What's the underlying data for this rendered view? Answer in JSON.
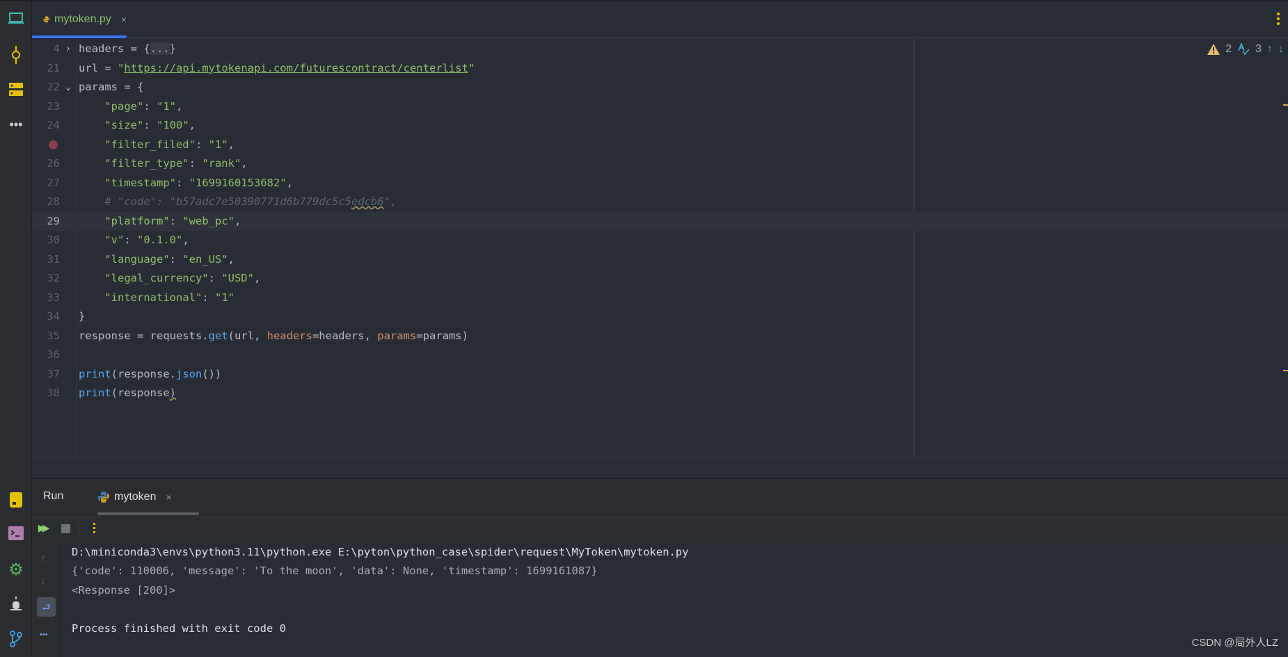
{
  "editor": {
    "tab": {
      "label": "mytoken.py",
      "close": "×",
      "icon": "python-icon"
    },
    "inspections": {
      "warnings": "2",
      "typos": "3"
    },
    "lines": [
      {
        "num": "4",
        "fold": "›",
        "tokens": [
          [
            "",
            "headers = {"
          ],
          [
            "t-fold",
            "..."
          ],
          [
            "",
            "}"
          ]
        ]
      },
      {
        "num": "21",
        "tokens": [
          [
            "",
            "url = "
          ],
          [
            "t-str",
            "\""
          ],
          [
            "t-url",
            "https://api.mytokenapi.com/futurescontract/centerlist"
          ],
          [
            "t-str",
            "\""
          ]
        ]
      },
      {
        "num": "22",
        "fold": "⌄",
        "tokens": [
          [
            "",
            "params = {"
          ]
        ]
      },
      {
        "num": "23",
        "tokens": [
          [
            "t-str",
            "    \"page\""
          ],
          [
            "",
            ": "
          ],
          [
            "t-str",
            "\"1\""
          ],
          [
            "",
            ","
          ]
        ]
      },
      {
        "num": "24",
        "tokens": [
          [
            "t-str",
            "    \"size\""
          ],
          [
            "",
            ": "
          ],
          [
            "t-str",
            "\"100\""
          ],
          [
            "",
            ","
          ]
        ]
      },
      {
        "num": "",
        "breakpoint": true,
        "tokens": [
          [
            "t-str",
            "    \"filter_filed\""
          ],
          [
            "",
            ": "
          ],
          [
            "t-str",
            "\"1\""
          ],
          [
            "",
            ","
          ]
        ]
      },
      {
        "num": "26",
        "tokens": [
          [
            "t-str",
            "    \"filter_type\""
          ],
          [
            "",
            ": "
          ],
          [
            "t-str",
            "\"rank\""
          ],
          [
            "",
            ","
          ]
        ]
      },
      {
        "num": "27",
        "tokens": [
          [
            "t-str",
            "    \"timestamp\""
          ],
          [
            "",
            ": "
          ],
          [
            "t-str",
            "\"1699160153682\""
          ],
          [
            "",
            ","
          ]
        ]
      },
      {
        "num": "28",
        "tokens": [
          [
            "t-cmt",
            "    # \"code\": \"b57adc7e50390771d6b779dc5c5"
          ],
          [
            "t-cmt t-warn",
            "edcb6"
          ],
          [
            "t-cmt",
            "\","
          ]
        ]
      },
      {
        "num": "29",
        "current": true,
        "tokens": [
          [
            "t-str",
            "    \"platform\""
          ],
          [
            "",
            ": "
          ],
          [
            "t-str",
            "\"web_pc\""
          ],
          [
            "",
            ","
          ]
        ]
      },
      {
        "num": "30",
        "tokens": [
          [
            "t-str",
            "    \"v\""
          ],
          [
            "",
            ": "
          ],
          [
            "t-str",
            "\"0.1.0\""
          ],
          [
            "",
            ","
          ]
        ]
      },
      {
        "num": "31",
        "tokens": [
          [
            "t-str",
            "    \"language\""
          ],
          [
            "",
            ": "
          ],
          [
            "t-str",
            "\"en_US\""
          ],
          [
            "",
            ","
          ]
        ]
      },
      {
        "num": "32",
        "tokens": [
          [
            "t-str",
            "    \"legal_currency\""
          ],
          [
            "",
            ": "
          ],
          [
            "t-str",
            "\"USD\""
          ],
          [
            "",
            ","
          ]
        ]
      },
      {
        "num": "33",
        "tokens": [
          [
            "t-str",
            "    \"international\""
          ],
          [
            "",
            ": "
          ],
          [
            "t-str",
            "\"1\""
          ]
        ]
      },
      {
        "num": "34",
        "tokens": [
          [
            "",
            "}"
          ]
        ]
      },
      {
        "num": "35",
        "tokens": [
          [
            "",
            "response = requests."
          ],
          [
            "t-fn",
            "get"
          ],
          [
            "",
            "(url, "
          ],
          [
            "t-kw",
            "headers"
          ],
          [
            "",
            "=headers, "
          ],
          [
            "t-kw",
            "params"
          ],
          [
            "",
            "=params)"
          ]
        ]
      },
      {
        "num": "36",
        "tokens": []
      },
      {
        "num": "37",
        "tokens": [
          [
            "t-bi",
            "print"
          ],
          [
            "",
            "(response."
          ],
          [
            "t-fn",
            "json"
          ],
          [
            "",
            "())"
          ]
        ]
      },
      {
        "num": "38",
        "tokens": [
          [
            "t-bi",
            "print"
          ],
          [
            "",
            "(response"
          ],
          [
            "t-warn",
            ")"
          ]
        ]
      }
    ]
  },
  "run": {
    "title": "Run",
    "tab": {
      "label": "mytoken",
      "close": "×"
    },
    "console": [
      {
        "text": "D:\\miniconda3\\envs\\python3.11\\python.exe E:\\pyton\\python_case\\spider\\request\\MyToken\\mytoken.py",
        "color": "#dfe1e5"
      },
      {
        "text": "{'code': 110006, 'message': 'To the moon', 'data': None, 'timestamp': 1699161087}",
        "color": "#a9adb5"
      },
      {
        "text": "<Response [200]>",
        "color": "#a9adb5"
      },
      {
        "text": "",
        "color": "#a9adb5"
      },
      {
        "text": "Process finished with exit code 0",
        "color": "#dfe1e5"
      }
    ]
  },
  "watermark": "CSDN @局外人LZ",
  "colors": {
    "accent": "#3574f0",
    "string": "#8fbf6b",
    "keyword": "#cf8e6d",
    "function": "#56a8f5"
  }
}
